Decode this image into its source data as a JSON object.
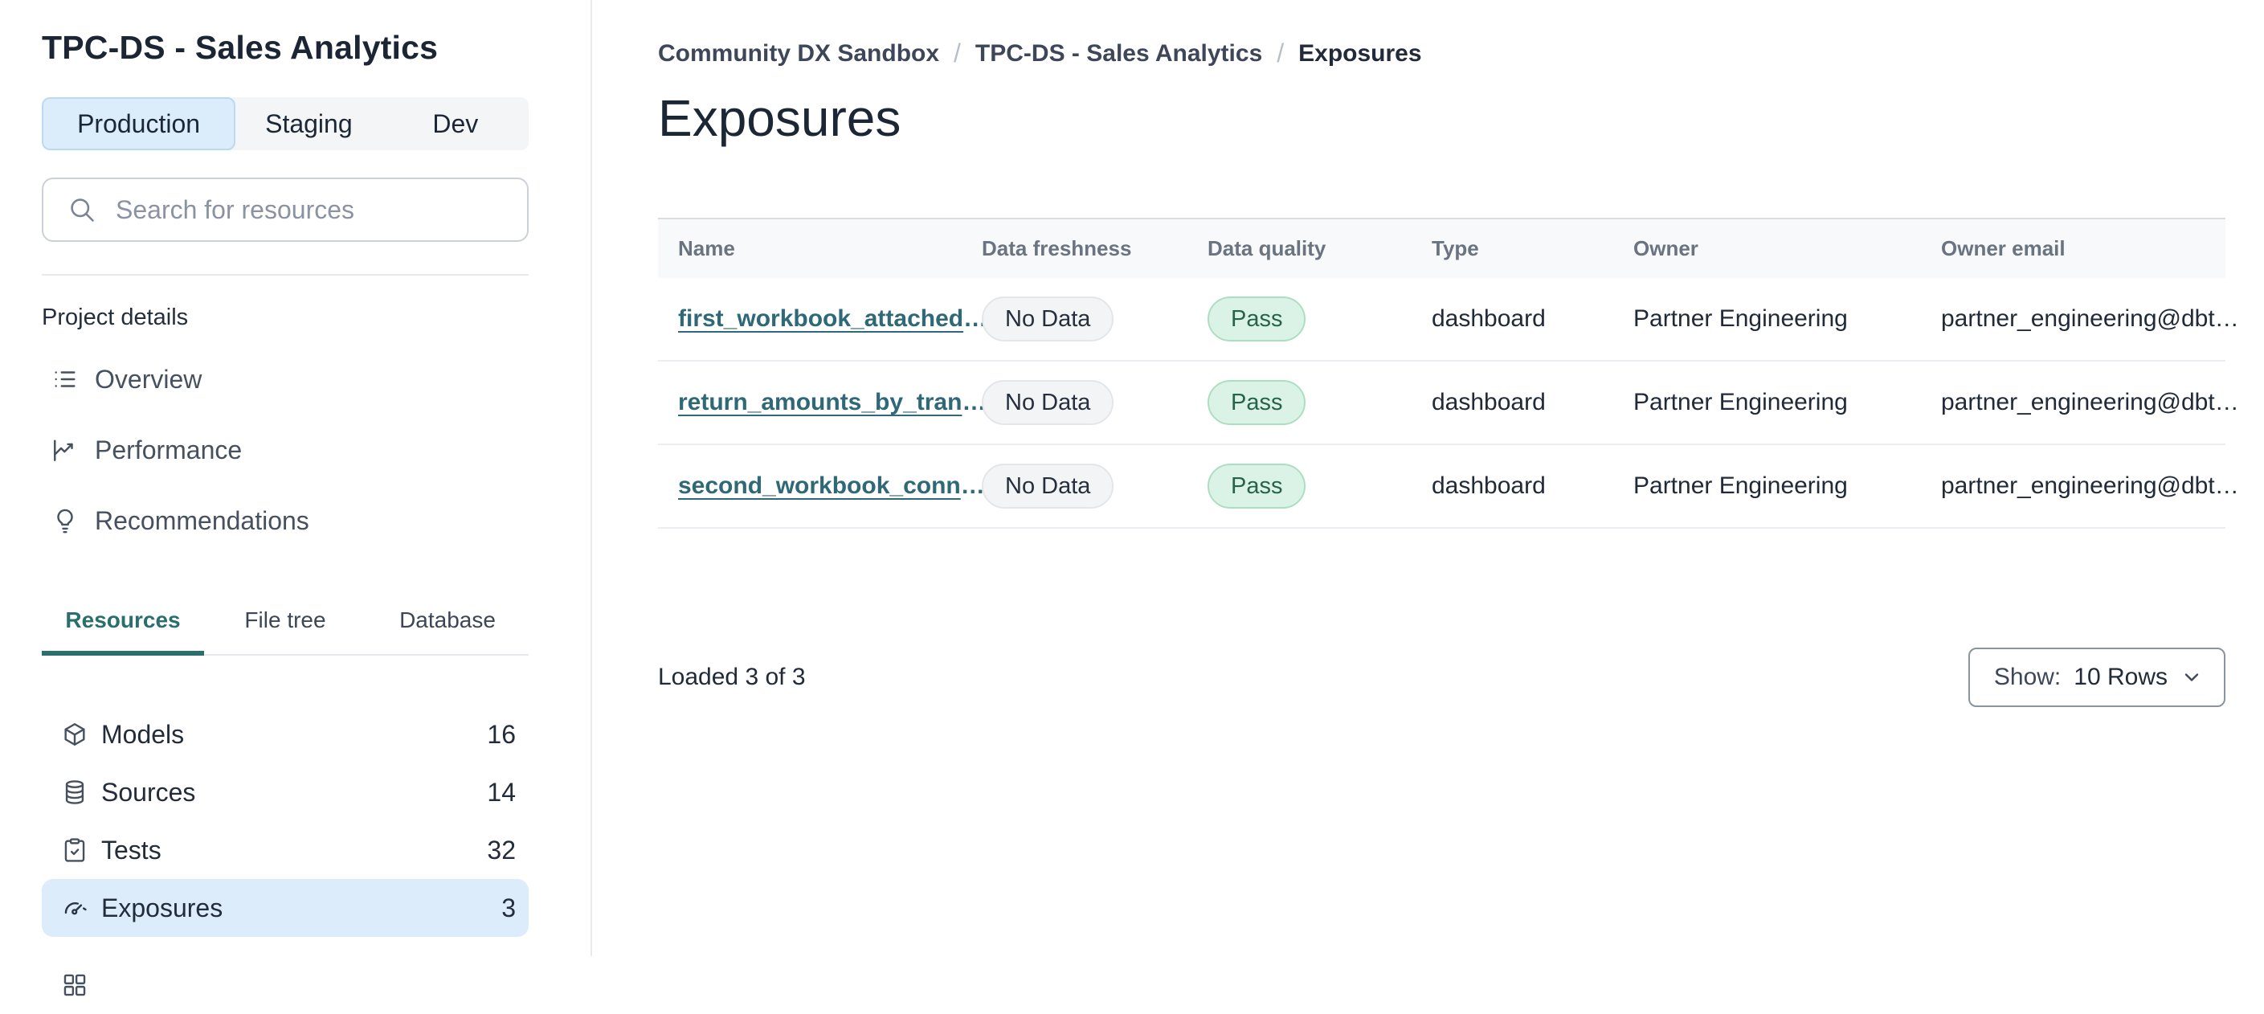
{
  "sidebar": {
    "title": "TPC-DS - Sales Analytics",
    "env_tabs": [
      {
        "label": "Production",
        "active": true
      },
      {
        "label": "Staging",
        "active": false
      },
      {
        "label": "Dev",
        "active": false
      }
    ],
    "search": {
      "placeholder": "Search for resources",
      "value": ""
    },
    "section_label": "Project details",
    "nav_items": [
      {
        "label": "Overview",
        "icon": "list-icon"
      },
      {
        "label": "Performance",
        "icon": "line-chart-icon"
      },
      {
        "label": "Recommendations",
        "icon": "lightbulb-icon"
      }
    ],
    "resource_tabs": [
      {
        "label": "Resources",
        "active": true
      },
      {
        "label": "File tree",
        "active": false
      },
      {
        "label": "Database",
        "active": false
      }
    ],
    "resource_items": [
      {
        "label": "Models",
        "count": "16",
        "icon": "cube-icon",
        "selected": false
      },
      {
        "label": "Sources",
        "count": "14",
        "icon": "database-icon",
        "selected": false
      },
      {
        "label": "Tests",
        "count": "32",
        "icon": "clipboard-check-icon",
        "selected": false
      },
      {
        "label": "Exposures",
        "count": "3",
        "icon": "gauge-icon",
        "selected": true
      }
    ]
  },
  "main": {
    "breadcrumb": [
      {
        "label": "Community DX Sandbox"
      },
      {
        "label": "TPC-DS - Sales Analytics"
      },
      {
        "label": "Exposures"
      }
    ],
    "breadcrumb_separator": "/",
    "title": "Exposures",
    "table": {
      "columns": [
        "Name",
        "Data freshness",
        "Data quality",
        "Type",
        "Owner",
        "Owner email"
      ],
      "ellipsis": "…",
      "rows": [
        {
          "name": "first_workbook_attached",
          "freshness": "No Data",
          "quality": "Pass",
          "type": "dashboard",
          "owner": "Partner Engineering",
          "email": "partner_engineering@dbt"
        },
        {
          "name": "return_amounts_by_tran",
          "freshness": "No Data",
          "quality": "Pass",
          "type": "dashboard",
          "owner": "Partner Engineering",
          "email": "partner_engineering@dbt"
        },
        {
          "name": "second_workbook_conn",
          "freshness": "No Data",
          "quality": "Pass",
          "type": "dashboard",
          "owner": "Partner Engineering",
          "email": "partner_engineering@dbt"
        }
      ]
    },
    "footer": {
      "loaded_text": "Loaded 3 of 3",
      "show_label": "Show:",
      "show_value": "10 Rows"
    }
  },
  "colors": {
    "link_teal": "#2f6876",
    "active_tab_teal": "#2a6e6d",
    "selected_row_blue": "#dcecfb",
    "production_tab_blue": "#dbedfb",
    "production_tab_border": "#badaf4",
    "pass_bg": "#dbf3e6",
    "pass_border": "#abdfc2",
    "pass_text": "#27634a",
    "no_data_bg": "#f3f4f6",
    "no_data_border": "#e4e6ea",
    "header_bg": "#f8f9fa"
  }
}
